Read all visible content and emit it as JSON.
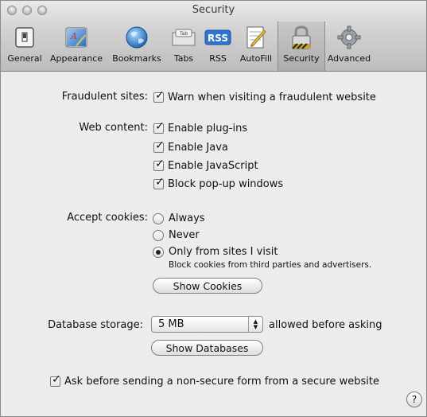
{
  "window": {
    "title": "Security"
  },
  "toolbar": {
    "items": [
      {
        "label": "General",
        "icon": "general-switch-icon"
      },
      {
        "label": "Appearance",
        "icon": "appearance-icon"
      },
      {
        "label": "Bookmarks",
        "icon": "globe-icon"
      },
      {
        "label": "Tabs",
        "icon": "tabs-icon",
        "icon_text": "Tab"
      },
      {
        "label": "RSS",
        "icon": "rss-icon",
        "icon_text": "RSS"
      },
      {
        "label": "AutoFill",
        "icon": "autofill-icon"
      },
      {
        "label": "Security",
        "icon": "lock-icon",
        "selected": true
      },
      {
        "label": "Advanced",
        "icon": "gear-icon"
      }
    ]
  },
  "fraudulent": {
    "label": "Fraudulent sites:",
    "option": "Warn when visiting a fraudulent website",
    "checked": true
  },
  "web_content": {
    "label": "Web content:",
    "options": [
      {
        "label": "Enable plug-ins",
        "checked": true
      },
      {
        "label": "Enable Java",
        "checked": true
      },
      {
        "label": "Enable JavaScript",
        "checked": true
      },
      {
        "label": "Block pop-up windows",
        "checked": true
      }
    ]
  },
  "cookies": {
    "label": "Accept cookies:",
    "options": [
      {
        "label": "Always",
        "selected": false
      },
      {
        "label": "Never",
        "selected": false
      },
      {
        "label": "Only from sites I visit",
        "selected": true
      }
    ],
    "note": "Block cookies from third parties and advertisers.",
    "show_button": "Show Cookies"
  },
  "database": {
    "label": "Database storage:",
    "value": "5 MB",
    "suffix": "allowed before asking",
    "show_button": "Show Databases"
  },
  "form_warning": {
    "label": "Ask before sending a non-secure form from a secure website",
    "checked": true
  },
  "help": {
    "label": "?"
  },
  "colors": {
    "selected_tab": "#b5b5b5",
    "rss_blue": "#2f74d0"
  }
}
